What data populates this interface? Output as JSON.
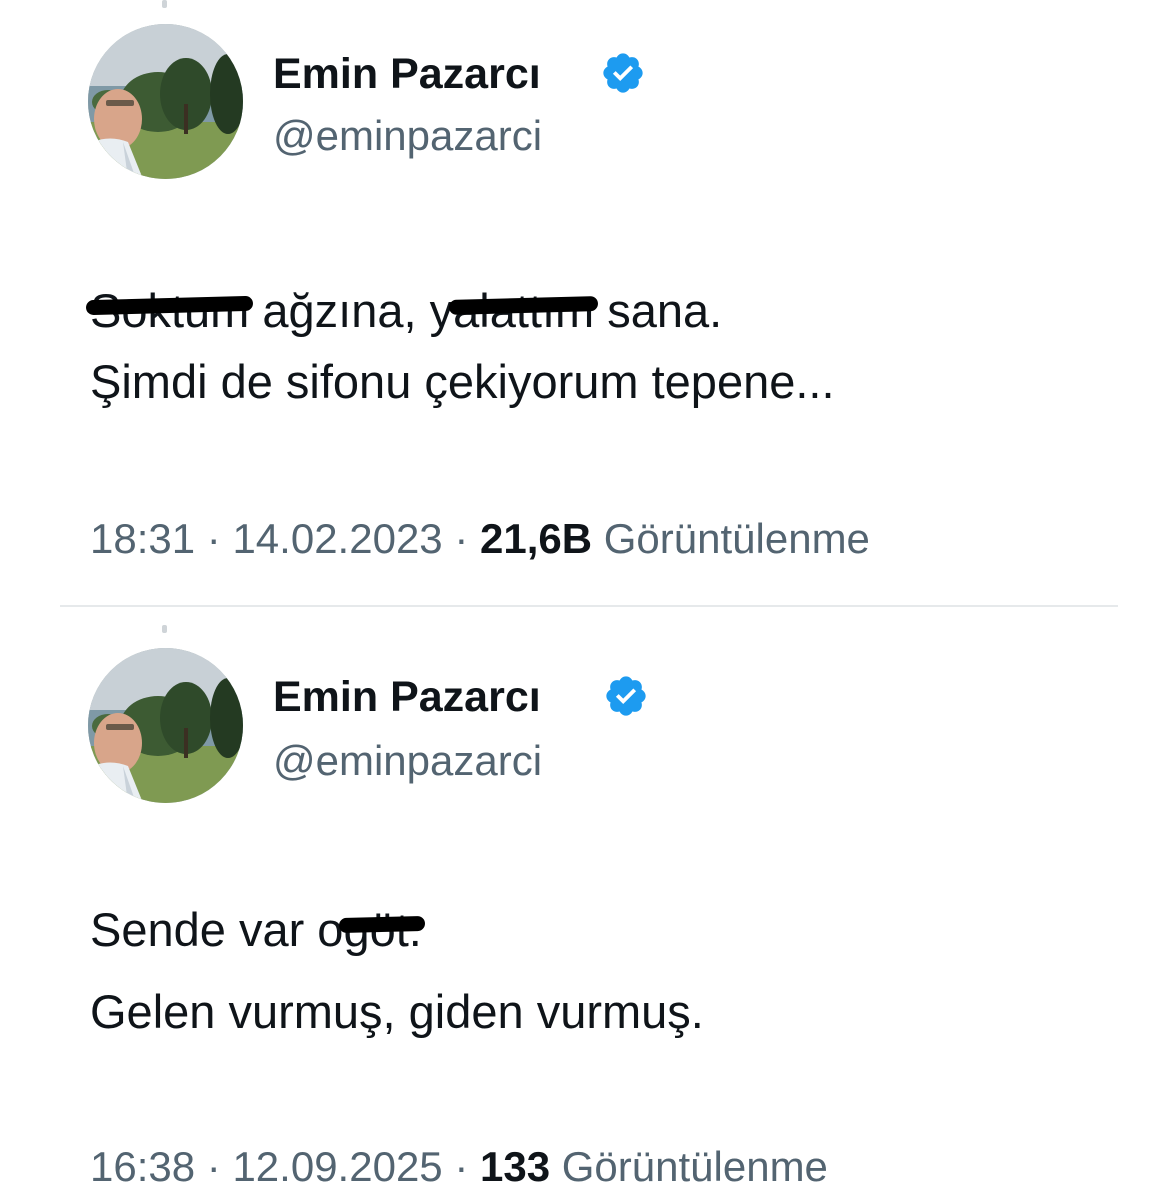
{
  "colors": {
    "text_primary": "#0f1419",
    "text_secondary": "#536471",
    "verified_badge": "#1d9bf0",
    "divider": "#e6e9eb"
  },
  "tweets": [
    {
      "author": {
        "display_name": "Emin Pazarcı",
        "handle": "@eminpazarci",
        "verified_icon": "verified-badge-icon"
      },
      "body": {
        "line1": {
          "redacted_1": "Soktum",
          "text_1": " ağzına, ",
          "prefix_2": "y",
          "redacted_2": "alattım",
          "text_2": " sana."
        },
        "line2": "Şimdi de sifonu çekiyorum tepene..."
      },
      "meta": {
        "time": "18:31",
        "date": "14.02.2023",
        "views_count": "21,6B",
        "views_label": "Görüntülenme"
      }
    },
    {
      "author": {
        "display_name": "Emin Pazarcı",
        "handle": "@eminpazarci",
        "verified_icon": "verified-badge-icon"
      },
      "body": {
        "line1": {
          "text_1": "Sende var o",
          "redacted_1": "göt."
        },
        "line2": "Gelen vurmuş, giden vurmuş."
      },
      "meta": {
        "time": "16:38",
        "date": "12.09.2025",
        "views_count": "133",
        "views_label": "Görüntülenme"
      }
    }
  ]
}
